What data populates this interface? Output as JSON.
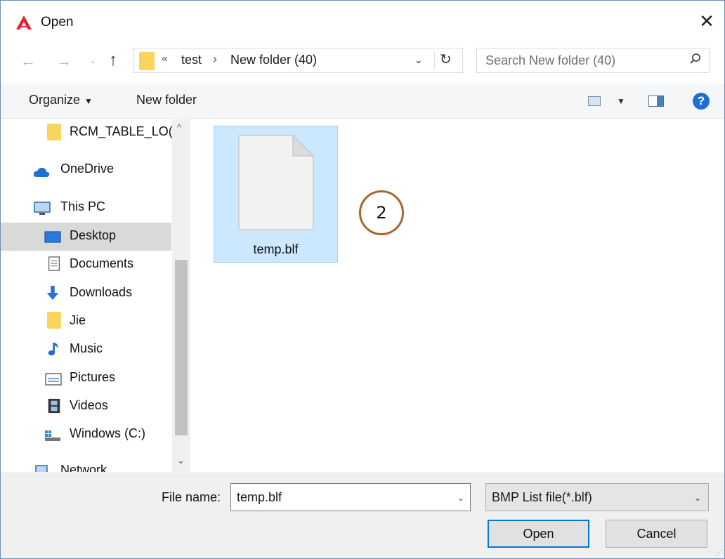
{
  "window": {
    "title": "Open",
    "close_glyph": "✕",
    "app_icon": "autocad-a-icon",
    "accent_color": "#e0262a"
  },
  "nav": {
    "back_glyph": "←",
    "forward_glyph": "→",
    "recent_glyph": "⌄",
    "up_glyph": "↑"
  },
  "address": {
    "overflow_glyph": "«",
    "crumbs": [
      "test",
      "New folder (40)"
    ],
    "separator": "›",
    "dropdown_glyph": "⌄",
    "refresh_glyph": "↻"
  },
  "search": {
    "placeholder": "Search New folder (40)"
  },
  "toolbar": {
    "organize_label": "Organize",
    "organize_caret": "▼",
    "new_folder_label": "New folder",
    "view_caret": "▼",
    "help_glyph": "?"
  },
  "sidebar": {
    "scroll_up_glyph": "^",
    "scroll_down_glyph": "⌄",
    "items": [
      {
        "label": "RCM_TABLE_LO(",
        "icon": "folder-icon"
      },
      {
        "label": "OneDrive",
        "icon": "cloud-icon"
      },
      {
        "label": "This PC",
        "icon": "computer-icon"
      },
      {
        "label": "Desktop",
        "icon": "desktop-icon",
        "selected": true
      },
      {
        "label": "Documents",
        "icon": "documents-icon"
      },
      {
        "label": "Downloads",
        "icon": "download-arrow-icon"
      },
      {
        "label": "Jie",
        "icon": "folder-icon"
      },
      {
        "label": "Music",
        "icon": "music-note-icon"
      },
      {
        "label": "Pictures",
        "icon": "pictures-icon"
      },
      {
        "label": "Videos",
        "icon": "film-icon"
      },
      {
        "label": "Windows (C:)",
        "icon": "drive-icon"
      },
      {
        "label": "Network",
        "icon": "network-icon"
      }
    ]
  },
  "files": [
    {
      "name": "temp.blf",
      "icon": "blank-file-icon",
      "selected": true
    }
  ],
  "annotation": {
    "number": "2",
    "color": "#a8662b"
  },
  "bottom": {
    "file_name_label": "File name:",
    "file_name_value": "temp.blf",
    "file_name_caret": "⌄",
    "file_type_value": "BMP List file(*.blf)",
    "file_type_caret": "⌄",
    "open_label": "Open",
    "cancel_label": "Cancel"
  }
}
